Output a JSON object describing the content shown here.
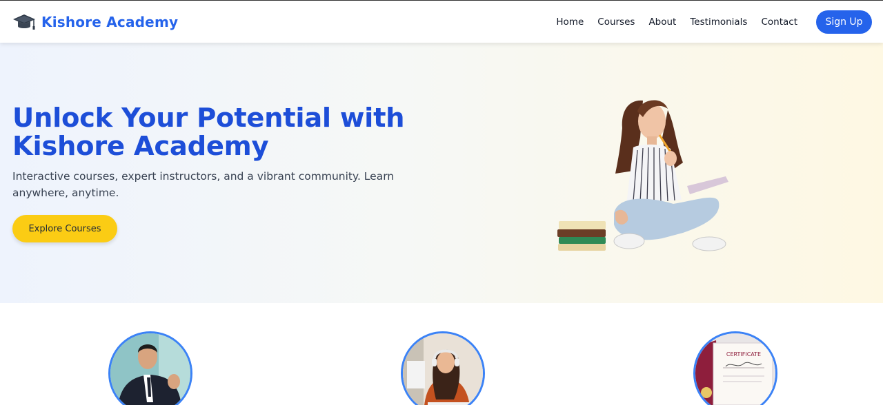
{
  "brand": {
    "name": "Kishore Academy",
    "icon": "graduation-cap-icon"
  },
  "nav": {
    "links": [
      "Home",
      "Courses",
      "About",
      "Testimonials",
      "Contact"
    ],
    "signup_label": "Sign Up"
  },
  "hero": {
    "title": "Unlock Your Potential with Kishore Academy",
    "subtitle": "Interactive courses, expert instructors, and a vibrant community. Learn anywhere, anytime.",
    "cta_label": "Explore Courses"
  },
  "features": [
    {
      "image": "instructor-photo"
    },
    {
      "image": "student-photo"
    },
    {
      "image": "certificate-photo",
      "certificate_text": "CERTIFICATE"
    }
  ],
  "colors": {
    "brand_blue": "#2563eb",
    "title_blue": "#1d4ed8",
    "cta_yellow": "#fbcc14",
    "ring_blue": "#3b82f6"
  }
}
